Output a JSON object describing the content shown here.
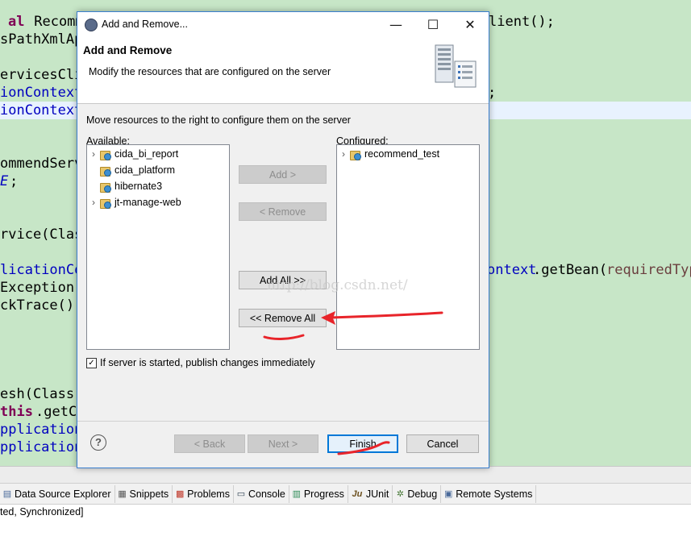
{
  "window": {
    "title": "Add and Remove...",
    "minimize_glyph": "—",
    "maximize_glyph": "☐",
    "close_glyph": "✕"
  },
  "banner": {
    "title": "Add and Remove",
    "description": "Modify the resources that are configured on the server",
    "image_icon": "server-icon"
  },
  "instruction": "Move resources to the right to configure them on the server",
  "available": {
    "label": "Available:",
    "items": [
      {
        "label": "cida_bi_report",
        "expandable": true
      },
      {
        "label": "cida_platform",
        "expandable": false
      },
      {
        "label": "hibernate3",
        "expandable": false
      },
      {
        "label": "jt-manage-web",
        "expandable": true
      }
    ]
  },
  "configured": {
    "label": "Configured:",
    "items": [
      {
        "label": "recommend_test",
        "expandable": true
      }
    ]
  },
  "buttons": {
    "add": "Add >",
    "remove": "< Remove",
    "add_all": "Add All >>",
    "remove_all": "<< Remove All",
    "back": "< Back",
    "next": "Next >",
    "finish": "Finish",
    "cancel": "Cancel"
  },
  "publish_checkbox": {
    "label": "If server is started, publish changes immediately",
    "checked": true
  },
  "help": "?",
  "watermark": "http://blog.csdn.net/",
  "views": [
    {
      "label": "Data Source Explorer",
      "icon": "data-source-icon"
    },
    {
      "label": "Snippets",
      "icon": "snippets-icon"
    },
    {
      "label": "Problems",
      "icon": "problems-icon"
    },
    {
      "label": "Console",
      "icon": "console-icon"
    },
    {
      "label": "Progress",
      "icon": "progress-icon"
    },
    {
      "label": "JUnit",
      "icon": "junit-icon"
    },
    {
      "label": "Debug",
      "icon": "debug-icon"
    },
    {
      "label": "Remote Systems",
      "icon": "remote-systems-icon"
    }
  ],
  "console_status": "ted, Synchronized]",
  "code_fragments": [
    {
      "text": "al",
      "color": "#7f0055",
      "bold": true
    },
    {
      "text": " Recomm",
      "color": "#000000"
    },
    {
      "text": "lient();",
      "color": "#000000"
    },
    {
      "text": "sPathXmlAp",
      "color": "#000000"
    },
    {
      "text": "ervicesCli",
      "color": "#000000"
    },
    {
      "text": "ionContext",
      "color": "#0000c0"
    },
    {
      "text": ";",
      "color": "#000000"
    },
    {
      "text": "ionContext",
      "color": "#0000c0"
    },
    {
      "text": "ommendServ",
      "color": "#000000"
    },
    {
      "text": "E",
      "color": "#0000c0"
    },
    {
      "text": ";",
      "color": "#000000"
    },
    {
      "text": "rvice(Clas",
      "color": "#000000"
    },
    {
      "text": "licationCo",
      "color": "#0000c0"
    },
    {
      "text": "ontext",
      "color": "#0000c0"
    },
    {
      "text": ".getBean(",
      "color": "#000000"
    },
    {
      "text": "requiredTyp",
      "color": "#6a3e3e"
    },
    {
      "text": "Exception",
      "color": "#000000"
    },
    {
      "text": "ckTrace()",
      "color": "#000000"
    },
    {
      "text": "esh(Class-",
      "color": "#000000"
    },
    {
      "text": "this",
      "color": "#7f0055",
      "bold": true
    },
    {
      "text": ".getCl",
      "color": "#000000"
    },
    {
      "text": "pplication",
      "color": "#0000c0"
    },
    {
      "text": "pplication",
      "color": "#0000c0"
    }
  ],
  "colors": {
    "editor_bg": "#c7e6c7",
    "dialog_border": "#3a7fcf",
    "annotation_red": "#e8242a",
    "default_button_border": "#0078d7"
  }
}
